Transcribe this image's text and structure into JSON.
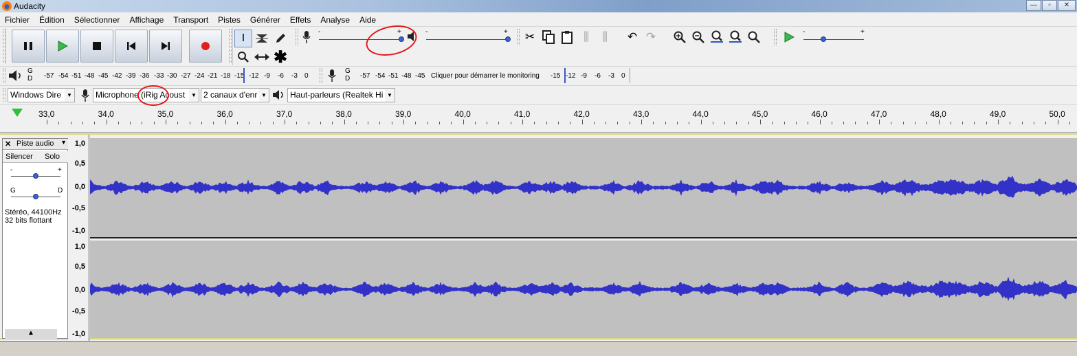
{
  "window": {
    "title": "Audacity",
    "minimize": "—",
    "maximize": "▫",
    "close": "✕"
  },
  "menu": [
    "Fichier",
    "Édition",
    "Sélectionner",
    "Affichage",
    "Transport",
    "Pistes",
    "Générer",
    "Effets",
    "Analyse",
    "Aide"
  ],
  "transport": {
    "pause_icon": "pause-icon",
    "play_icon": "play-icon",
    "stop_icon": "stop-icon",
    "skip_start_icon": "skip-start-icon",
    "skip_end_icon": "skip-end-icon",
    "record_icon": "record-icon"
  },
  "mixer": {
    "minus": "-",
    "plus": "+"
  },
  "meters": {
    "record_scale": [
      "-57",
      "-54",
      "-51",
      "-48",
      "-45",
      "-42",
      "-39",
      "-36",
      "-33",
      "-30",
      "-27",
      "-24",
      "-21",
      "-18",
      "-15",
      "-12",
      "-9",
      "-6",
      "-3",
      "0"
    ],
    "play_scale_left": [
      "-57",
      "-54",
      "-51",
      "-48",
      "-45"
    ],
    "play_scale_right": [
      "-15",
      "-12",
      "-9",
      "-6",
      "-3",
      "0"
    ],
    "monitor_text": "Cliquer pour démarrer le monitoring",
    "channel_g": "G",
    "channel_d": "D"
  },
  "devices": {
    "host": "Windows Dire",
    "mic_text": "Microphone (iRig Acoust",
    "channels": "2 canaux d'enr",
    "speakers": "Haut-parleurs (Realtek Hi"
  },
  "timeline": {
    "labels": [
      "33,0",
      "34,0",
      "35,0",
      "36,0",
      "37,0",
      "38,0",
      "39,0",
      "40,0",
      "41,0",
      "42,0",
      "43,0",
      "44,0",
      "45,0",
      "46,0",
      "47,0",
      "48,0",
      "49,0",
      "50,0"
    ]
  },
  "track": {
    "name": "Piste audio",
    "close": "✕",
    "mute": "Silencer",
    "solo": "Solo",
    "gain_minus": "-",
    "gain_plus": "+",
    "pan_left": "G",
    "pan_right": "D",
    "info_line1": "Stéréo, 44100Hz",
    "info_line2": "32 bits flottant",
    "collapse": "▲",
    "ruler": [
      "1,0",
      "0,5",
      "0,0",
      "-0,5",
      "-1,0"
    ]
  },
  "colors": {
    "waveform": "#3232c8",
    "wave_bg": "#c0c0c0",
    "selection_border": "#d9d77e",
    "annotation": "#e3191c"
  }
}
